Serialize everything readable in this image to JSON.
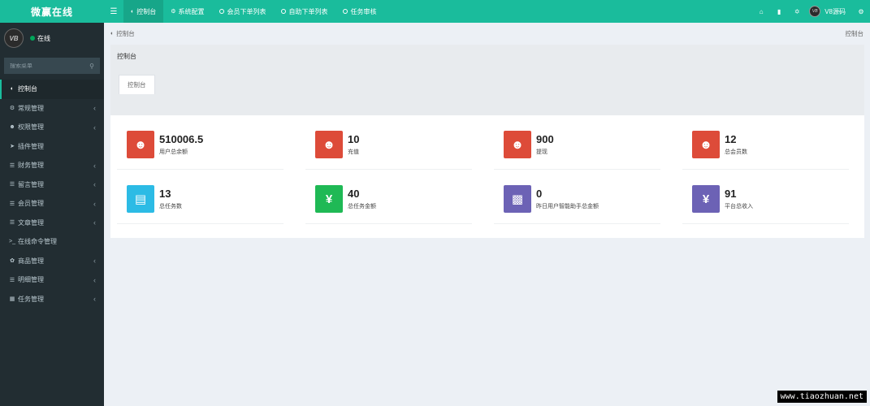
{
  "app": {
    "logo_text": "微赢在线"
  },
  "user": {
    "avatar_text": "VB",
    "status": "在线",
    "name": "V8源码"
  },
  "search": {
    "placeholder": "搜索菜单"
  },
  "sidebar": {
    "items": [
      {
        "label": "控制台",
        "icon": "dashboard-icon",
        "active": true,
        "has_children": false
      },
      {
        "label": "常规管理",
        "icon": "cogs-icon",
        "has_children": true
      },
      {
        "label": "权限管理",
        "icon": "users-icon",
        "has_children": true
      },
      {
        "label": "插件管理",
        "icon": "rocket-icon",
        "has_children": false
      },
      {
        "label": "财务管理",
        "icon": "list-icon",
        "has_children": true
      },
      {
        "label": "留言管理",
        "icon": "list-icon",
        "has_children": true
      },
      {
        "label": "会员管理",
        "icon": "list-icon",
        "has_children": true
      },
      {
        "label": "文章管理",
        "icon": "list-icon",
        "has_children": true
      },
      {
        "label": "在线命令管理",
        "icon": "terminal-icon",
        "has_children": false
      },
      {
        "label": "商品管理",
        "icon": "leaf-icon",
        "has_children": true
      },
      {
        "label": "明细管理",
        "icon": "list-icon",
        "has_children": true
      },
      {
        "label": "任务管理",
        "icon": "table-icon",
        "has_children": true
      }
    ]
  },
  "topbar": {
    "tabs": [
      {
        "label": "控制台",
        "icon": "dashboard-icon",
        "active": true
      },
      {
        "label": "系统配置",
        "icon": "gear-icon"
      },
      {
        "label": "会员下单列表",
        "icon": "circle-icon"
      },
      {
        "label": "自助下单列表",
        "icon": "circle-icon"
      },
      {
        "label": "任务审核",
        "icon": "circle-icon"
      }
    ]
  },
  "content": {
    "breadcrumb": "控制台",
    "breadcrumb_right": "控制台",
    "panel_title": "控制台",
    "panel_tab": "控制台",
    "stats": [
      {
        "value": "510006.5",
        "label": "用户总余额",
        "icon": "users-icon",
        "color": "#dd4b39"
      },
      {
        "value": "10",
        "label": "充值",
        "icon": "users-icon",
        "color": "#dd4b39"
      },
      {
        "value": "900",
        "label": "提现",
        "icon": "users-icon",
        "color": "#dd4b39"
      },
      {
        "value": "12",
        "label": "总会员数",
        "icon": "users-icon",
        "color": "#dd4b39"
      },
      {
        "value": "13",
        "label": "总任务数",
        "icon": "shopping-bag-icon",
        "color": "#2cbbe5"
      },
      {
        "value": "40",
        "label": "总任务金额",
        "icon": "yen-icon",
        "color": "#1fb955"
      },
      {
        "value": "0",
        "label": "昨日用户智能助手总金额",
        "icon": "book-icon",
        "color": "#6c62b5"
      },
      {
        "value": "91",
        "label": "平台总收入",
        "icon": "yen-icon",
        "color": "#6c62b5"
      }
    ]
  },
  "watermark": "www.tiaozhuan.net"
}
